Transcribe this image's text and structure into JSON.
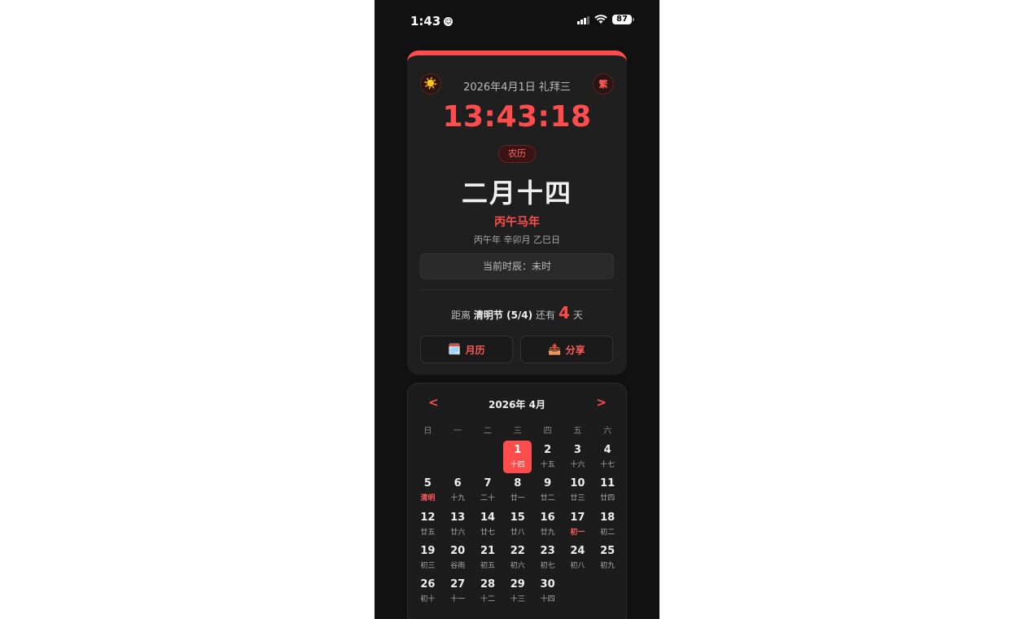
{
  "status_bar": {
    "time": "1:43",
    "battery": "87"
  },
  "header": {
    "date": "2026年4月1日 礼拜三",
    "theme_icon": "☀️",
    "lang_label": "繁"
  },
  "clock": "13:43:18",
  "lunar": {
    "badge": "农历",
    "date": "二月十四",
    "zodiac_year": "丙午马年",
    "ganzhi": "丙午年 辛卯月 乙巳日",
    "shichen": "当前时辰：未时"
  },
  "countdown": {
    "prefix": "距离",
    "festival": "清明节 (5/4)",
    "middle": "还有",
    "days": "4",
    "suffix": "天"
  },
  "actions": {
    "calendar_icon": "🗓️",
    "calendar_label": "月历",
    "share_icon": "📤",
    "share_label": "分享"
  },
  "calendar": {
    "prev": "<",
    "next": ">",
    "title": "2026年 4月",
    "weekdays": [
      "日",
      "一",
      "二",
      "三",
      "四",
      "五",
      "六"
    ],
    "leading_blanks": 3,
    "today": 1,
    "days": [
      {
        "num": "1",
        "lunar": "十四"
      },
      {
        "num": "2",
        "lunar": "十五"
      },
      {
        "num": "3",
        "lunar": "十六"
      },
      {
        "num": "4",
        "lunar": "十七"
      },
      {
        "num": "5",
        "lunar": "清明",
        "highlight": true
      },
      {
        "num": "6",
        "lunar": "十九"
      },
      {
        "num": "7",
        "lunar": "二十"
      },
      {
        "num": "8",
        "lunar": "廿一"
      },
      {
        "num": "9",
        "lunar": "廿二"
      },
      {
        "num": "10",
        "lunar": "廿三"
      },
      {
        "num": "11",
        "lunar": "廿四"
      },
      {
        "num": "12",
        "lunar": "廿五"
      },
      {
        "num": "13",
        "lunar": "廿六"
      },
      {
        "num": "14",
        "lunar": "廿七"
      },
      {
        "num": "15",
        "lunar": "廿八"
      },
      {
        "num": "16",
        "lunar": "廿九"
      },
      {
        "num": "17",
        "lunar": "初一",
        "highlight": true
      },
      {
        "num": "18",
        "lunar": "初二"
      },
      {
        "num": "19",
        "lunar": "初三"
      },
      {
        "num": "20",
        "lunar": "谷雨"
      },
      {
        "num": "21",
        "lunar": "初五"
      },
      {
        "num": "22",
        "lunar": "初六"
      },
      {
        "num": "23",
        "lunar": "初七"
      },
      {
        "num": "24",
        "lunar": "初八"
      },
      {
        "num": "25",
        "lunar": "初九"
      },
      {
        "num": "26",
        "lunar": "初十"
      },
      {
        "num": "27",
        "lunar": "十一"
      },
      {
        "num": "28",
        "lunar": "十二"
      },
      {
        "num": "29",
        "lunar": "十三"
      },
      {
        "num": "30",
        "lunar": "十四"
      }
    ]
  },
  "colors": {
    "accent": "#ff4d4d",
    "background": "#111111",
    "card": "#1f1f1f"
  }
}
